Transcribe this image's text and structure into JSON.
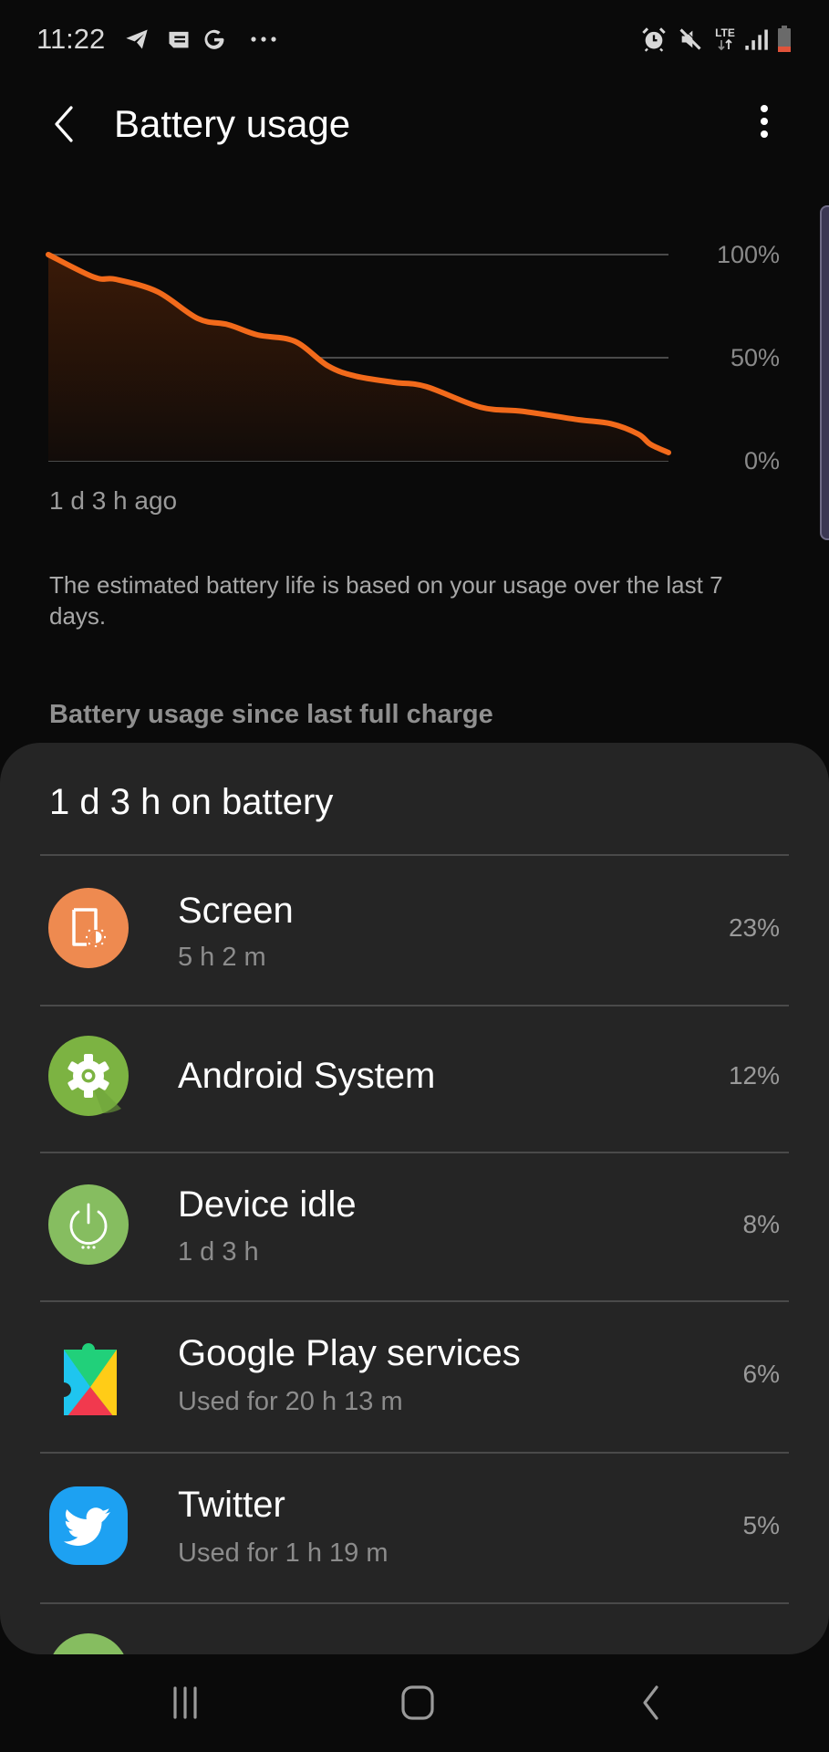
{
  "status_bar": {
    "time": "11:22",
    "left_icons": [
      "telegram-icon",
      "news-icon",
      "google-icon",
      "more-notifications-icon"
    ],
    "right_icons": [
      "alarm-icon",
      "mute-icon",
      "lte-icon",
      "signal-icon",
      "battery-low-icon"
    ],
    "network_label": "LTE",
    "battery_color": "#e0533a"
  },
  "app_bar": {
    "title": "Battery usage",
    "back_icon": "chevron-left-icon",
    "menu_icon": "more-vert-icon"
  },
  "chart_data": {
    "type": "area",
    "title": "",
    "xlabel": "",
    "ylabel": "",
    "x_start_label": "1 d 3 h ago",
    "x_unit": "fraction of elapsed time (0 = 1 d 3 h ago, 1 = now)",
    "ylim": [
      0,
      100
    ],
    "y_ticks": [
      100,
      50,
      0
    ],
    "y_tick_labels": [
      "100%",
      "50%",
      "0%"
    ],
    "grid": true,
    "line_color": "#f26a1b",
    "series": [
      {
        "name": "Battery level",
        "x": [
          0.0,
          0.074,
          0.109,
          0.176,
          0.241,
          0.29,
          0.338,
          0.397,
          0.451,
          0.496,
          0.559,
          0.609,
          0.697,
          0.765,
          0.853,
          0.907,
          0.951,
          0.971,
          1.0
        ],
        "values": [
          100,
          89,
          88,
          82,
          69,
          66,
          61,
          58,
          46,
          41,
          38,
          36,
          26,
          24,
          20,
          18,
          13,
          8,
          4
        ]
      }
    ]
  },
  "estimate_text": "The estimated battery life is based on your usage over the last 7 days.",
  "section_header": "Battery usage since last full charge",
  "usage": {
    "total_label": "1 d 3 h on battery",
    "items": [
      {
        "name": "Screen",
        "detail": "5 h 2 m",
        "percent": "23%",
        "icon": "screen-brightness-icon",
        "icon_color": "#ee8a50"
      },
      {
        "name": "Android System",
        "detail": "",
        "percent": "12%",
        "icon": "gear-icon",
        "icon_color": "#7cb342"
      },
      {
        "name": "Device idle",
        "detail": "1 d 3 h",
        "percent": "8%",
        "icon": "power-icon",
        "icon_color": "#86bd60"
      },
      {
        "name": "Google Play services",
        "detail": "Used for 20 h 13 m",
        "percent": "6%",
        "icon": "google-play-services-icon",
        "icon_color": ""
      },
      {
        "name": "Twitter",
        "detail": "Used for 1 h 19 m",
        "percent": "5%",
        "icon": "twitter-icon",
        "icon_color": "#1da1f2"
      }
    ]
  },
  "nav_bar": {
    "buttons": [
      "recents-icon",
      "home-icon",
      "back-icon"
    ]
  }
}
